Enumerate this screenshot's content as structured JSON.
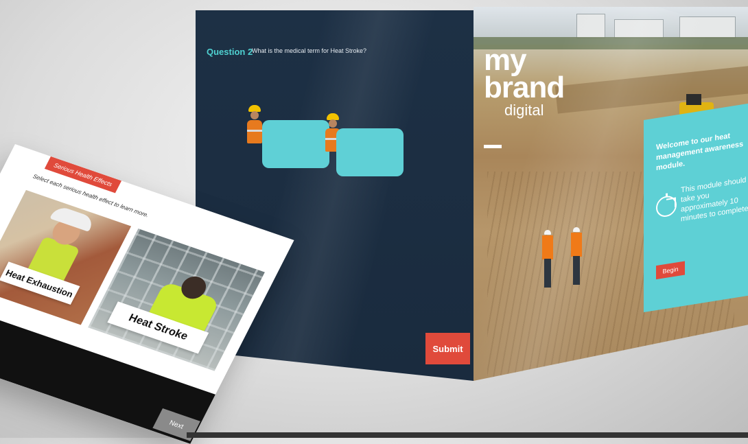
{
  "quiz": {
    "question_number": "Question 2",
    "question_text": "What is the medical term for Heat Stroke?",
    "submit_label": "Submit"
  },
  "front": {
    "tag": "Serious Health Effects",
    "instruction": "Select each serious health effect to learn more.",
    "card_1_label": "Heat Exhaustion",
    "card_2_label": "Heat Stroke",
    "next_label": "Next",
    "logo_my": "my",
    "logo_brand": "brand",
    "logo_digital": "digital"
  },
  "welcome": {
    "logo_my": "my",
    "logo_brand": "brand",
    "logo_digital": "digital",
    "title": "Welcome to our heat management awareness module.",
    "body": "This module should take you approximately 10 minutes to complete.",
    "begin_label": "Begin"
  },
  "colors": {
    "accent_red": "#e04a3b",
    "accent_cyan": "#5ed0d5",
    "navy": "#1d3045"
  }
}
